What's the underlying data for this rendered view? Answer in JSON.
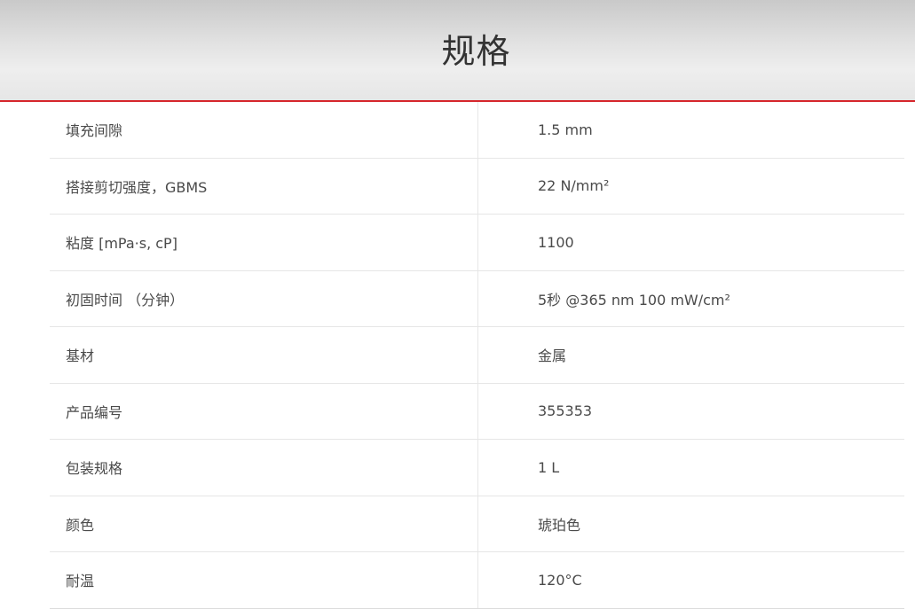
{
  "header": {
    "title": "规格"
  },
  "specs": [
    {
      "label": "填充间隙",
      "value": "1.5 mm"
    },
    {
      "label": "搭接剪切强度，GBMS",
      "value": "22 N/mm²"
    },
    {
      "label": "粘度 [mPa·s, cP]",
      "value": "1100"
    },
    {
      "label": "初固时间 （分钟）",
      "value": "5秒 @365 nm 100 mW/cm²"
    },
    {
      "label": "基材",
      "value": "金属"
    },
    {
      "label": "产品编号",
      "value": "355353"
    },
    {
      "label": "包装规格",
      "value": "1 L"
    },
    {
      "label": "颜色",
      "value": "琥珀色"
    },
    {
      "label": "耐温",
      "value": "120°C"
    }
  ],
  "colors": {
    "accent_rule": "#d6262c",
    "text": "#4a4a4a",
    "divider": "#e6e6e6"
  }
}
